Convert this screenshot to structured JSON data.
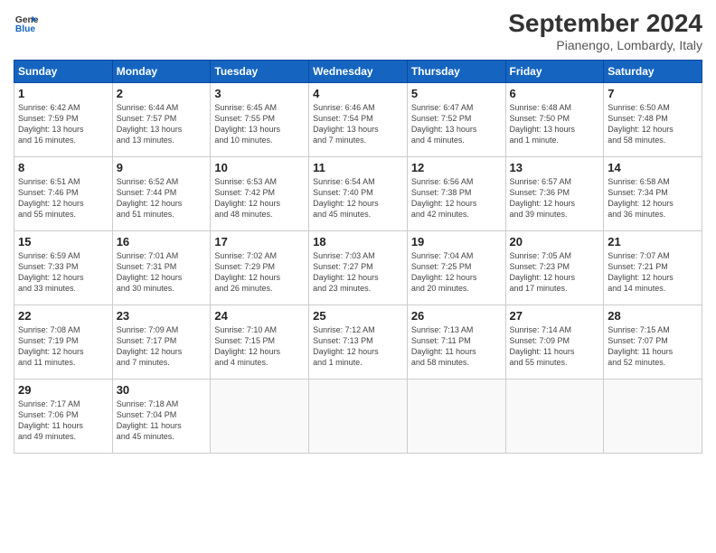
{
  "header": {
    "logo_general": "General",
    "logo_blue": "Blue",
    "month_title": "September 2024",
    "subtitle": "Pianengo, Lombardy, Italy"
  },
  "weekdays": [
    "Sunday",
    "Monday",
    "Tuesday",
    "Wednesday",
    "Thursday",
    "Friday",
    "Saturday"
  ],
  "weeks": [
    [
      {
        "day": "1",
        "info": "Sunrise: 6:42 AM\nSunset: 7:59 PM\nDaylight: 13 hours\nand 16 minutes."
      },
      {
        "day": "2",
        "info": "Sunrise: 6:44 AM\nSunset: 7:57 PM\nDaylight: 13 hours\nand 13 minutes."
      },
      {
        "day": "3",
        "info": "Sunrise: 6:45 AM\nSunset: 7:55 PM\nDaylight: 13 hours\nand 10 minutes."
      },
      {
        "day": "4",
        "info": "Sunrise: 6:46 AM\nSunset: 7:54 PM\nDaylight: 13 hours\nand 7 minutes."
      },
      {
        "day": "5",
        "info": "Sunrise: 6:47 AM\nSunset: 7:52 PM\nDaylight: 13 hours\nand 4 minutes."
      },
      {
        "day": "6",
        "info": "Sunrise: 6:48 AM\nSunset: 7:50 PM\nDaylight: 13 hours\nand 1 minute."
      },
      {
        "day": "7",
        "info": "Sunrise: 6:50 AM\nSunset: 7:48 PM\nDaylight: 12 hours\nand 58 minutes."
      }
    ],
    [
      {
        "day": "8",
        "info": "Sunrise: 6:51 AM\nSunset: 7:46 PM\nDaylight: 12 hours\nand 55 minutes."
      },
      {
        "day": "9",
        "info": "Sunrise: 6:52 AM\nSunset: 7:44 PM\nDaylight: 12 hours\nand 51 minutes."
      },
      {
        "day": "10",
        "info": "Sunrise: 6:53 AM\nSunset: 7:42 PM\nDaylight: 12 hours\nand 48 minutes."
      },
      {
        "day": "11",
        "info": "Sunrise: 6:54 AM\nSunset: 7:40 PM\nDaylight: 12 hours\nand 45 minutes."
      },
      {
        "day": "12",
        "info": "Sunrise: 6:56 AM\nSunset: 7:38 PM\nDaylight: 12 hours\nand 42 minutes."
      },
      {
        "day": "13",
        "info": "Sunrise: 6:57 AM\nSunset: 7:36 PM\nDaylight: 12 hours\nand 39 minutes."
      },
      {
        "day": "14",
        "info": "Sunrise: 6:58 AM\nSunset: 7:34 PM\nDaylight: 12 hours\nand 36 minutes."
      }
    ],
    [
      {
        "day": "15",
        "info": "Sunrise: 6:59 AM\nSunset: 7:33 PM\nDaylight: 12 hours\nand 33 minutes."
      },
      {
        "day": "16",
        "info": "Sunrise: 7:01 AM\nSunset: 7:31 PM\nDaylight: 12 hours\nand 30 minutes."
      },
      {
        "day": "17",
        "info": "Sunrise: 7:02 AM\nSunset: 7:29 PM\nDaylight: 12 hours\nand 26 minutes."
      },
      {
        "day": "18",
        "info": "Sunrise: 7:03 AM\nSunset: 7:27 PM\nDaylight: 12 hours\nand 23 minutes."
      },
      {
        "day": "19",
        "info": "Sunrise: 7:04 AM\nSunset: 7:25 PM\nDaylight: 12 hours\nand 20 minutes."
      },
      {
        "day": "20",
        "info": "Sunrise: 7:05 AM\nSunset: 7:23 PM\nDaylight: 12 hours\nand 17 minutes."
      },
      {
        "day": "21",
        "info": "Sunrise: 7:07 AM\nSunset: 7:21 PM\nDaylight: 12 hours\nand 14 minutes."
      }
    ],
    [
      {
        "day": "22",
        "info": "Sunrise: 7:08 AM\nSunset: 7:19 PM\nDaylight: 12 hours\nand 11 minutes."
      },
      {
        "day": "23",
        "info": "Sunrise: 7:09 AM\nSunset: 7:17 PM\nDaylight: 12 hours\nand 7 minutes."
      },
      {
        "day": "24",
        "info": "Sunrise: 7:10 AM\nSunset: 7:15 PM\nDaylight: 12 hours\nand 4 minutes."
      },
      {
        "day": "25",
        "info": "Sunrise: 7:12 AM\nSunset: 7:13 PM\nDaylight: 12 hours\nand 1 minute."
      },
      {
        "day": "26",
        "info": "Sunrise: 7:13 AM\nSunset: 7:11 PM\nDaylight: 11 hours\nand 58 minutes."
      },
      {
        "day": "27",
        "info": "Sunrise: 7:14 AM\nSunset: 7:09 PM\nDaylight: 11 hours\nand 55 minutes."
      },
      {
        "day": "28",
        "info": "Sunrise: 7:15 AM\nSunset: 7:07 PM\nDaylight: 11 hours\nand 52 minutes."
      }
    ],
    [
      {
        "day": "29",
        "info": "Sunrise: 7:17 AM\nSunset: 7:06 PM\nDaylight: 11 hours\nand 49 minutes."
      },
      {
        "day": "30",
        "info": "Sunrise: 7:18 AM\nSunset: 7:04 PM\nDaylight: 11 hours\nand 45 minutes."
      },
      {
        "day": "",
        "info": ""
      },
      {
        "day": "",
        "info": ""
      },
      {
        "day": "",
        "info": ""
      },
      {
        "day": "",
        "info": ""
      },
      {
        "day": "",
        "info": ""
      }
    ]
  ]
}
